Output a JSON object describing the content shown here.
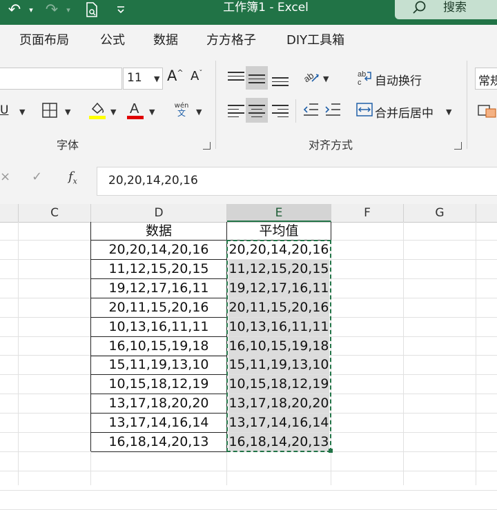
{
  "title_bar": {
    "title": "工作簿1  -  Excel",
    "search_label": "搜索"
  },
  "menu_tabs": [
    "页面布局",
    "公式",
    "数据",
    "方方格子",
    "DIY工具箱"
  ],
  "ribbon": {
    "font_size": "11",
    "wrap_text_label": "自动换行",
    "merge_center_label": "合并后居中",
    "number_format": "常规",
    "font_group_label": "字体",
    "alignment_group_label": "对齐方式",
    "phonetic_top": "wén",
    "phonetic_bottom": "文",
    "highlight_color": "#ffff00",
    "font_color": "#e00000"
  },
  "formula_bar": {
    "content": "20,20,14,20,16"
  },
  "columns": [
    "C",
    "D",
    "E",
    "F",
    "G"
  ],
  "selected_column": "E",
  "table": {
    "header_d": "数据",
    "header_e": "平均值",
    "rows": [
      {
        "d": "20,20,14,20,16",
        "e": "20,20,14,20,16"
      },
      {
        "d": "11,12,15,20,15",
        "e": "11,12,15,20,15"
      },
      {
        "d": "19,12,17,16,11",
        "e": "19,12,17,16,11"
      },
      {
        "d": "20,11,15,20,16",
        "e": "20,11,15,20,16"
      },
      {
        "d": "10,13,16,11,11",
        "e": "10,13,16,11,11"
      },
      {
        "d": "16,10,15,19,18",
        "e": "16,10,15,19,18"
      },
      {
        "d": "15,11,19,13,10",
        "e": "15,11,19,13,10"
      },
      {
        "d": "10,15,18,12,19",
        "e": "10,15,18,12,19"
      },
      {
        "d": "13,17,18,20,20",
        "e": "13,17,18,20,20"
      },
      {
        "d": "13,17,14,16,14",
        "e": "13,17,14,16,14"
      },
      {
        "d": "16,18,14,20,13",
        "e": "16,18,14,20,13"
      }
    ]
  },
  "colors": {
    "excel_green": "#217346",
    "selection_border": "#217346"
  }
}
